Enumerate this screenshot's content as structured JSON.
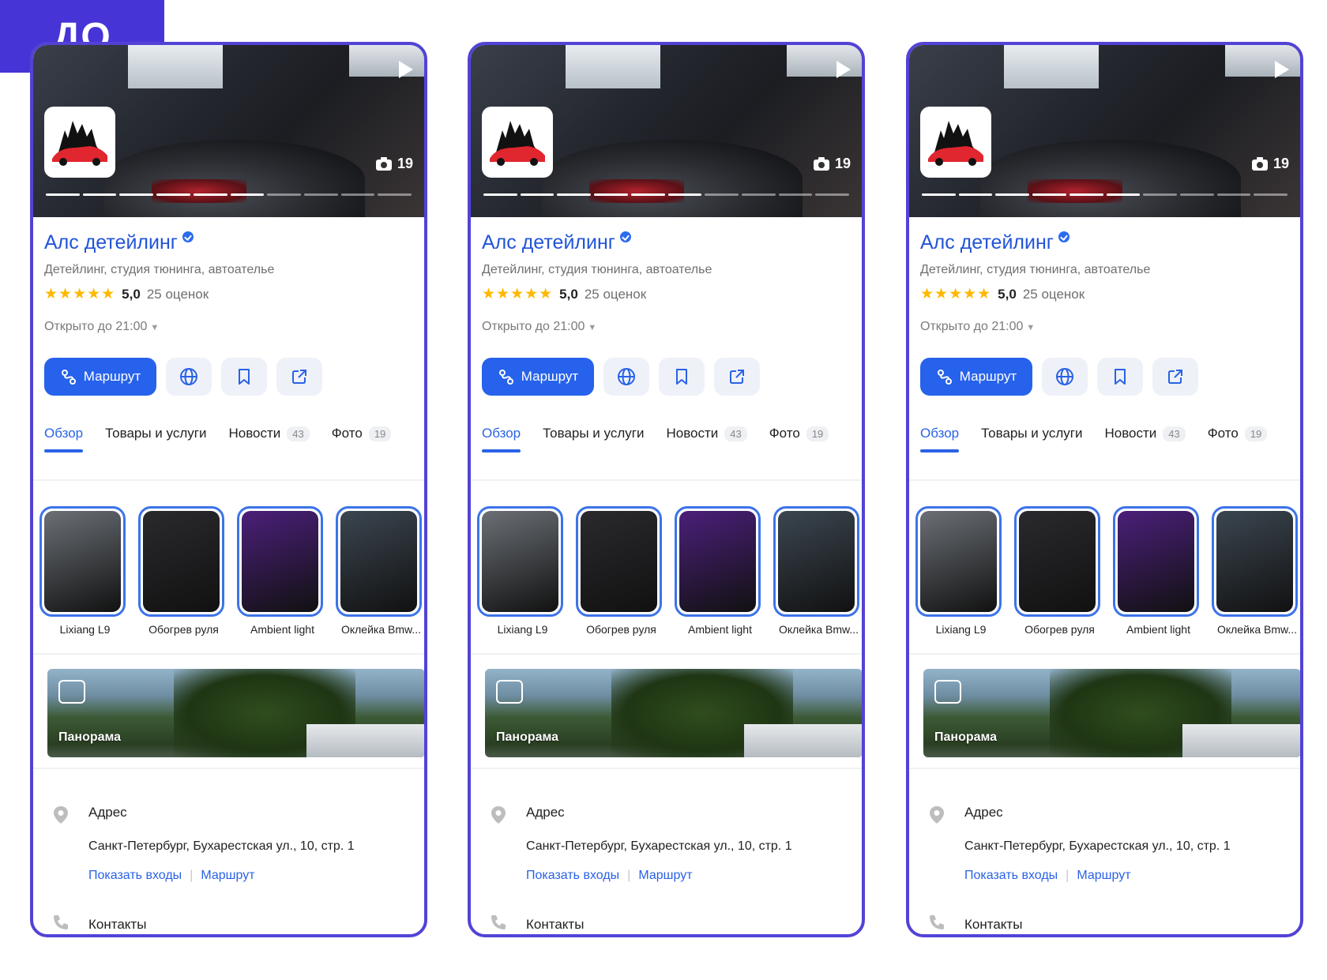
{
  "badge": "ДО",
  "card": {
    "photo_count": "19",
    "title": "Алс детейлинг",
    "subtitle": "Детейлинг, студия тюнинга, автоателье",
    "stars": "★★★★★",
    "rating": "5,0",
    "rating_count": "25 оценок",
    "hours": "Открыто до 21:00",
    "hours_caret": "▼",
    "route_label": "Маршрут",
    "tabs": [
      {
        "label": "Обзор",
        "count": ""
      },
      {
        "label": "Товары и услуги",
        "count": ""
      },
      {
        "label": "Новости",
        "count": "43"
      },
      {
        "label": "Фото",
        "count": "19"
      }
    ],
    "stories": [
      {
        "label": "Lixiang L9",
        "color": "#6b7076"
      },
      {
        "label": "Обогрев руля",
        "color": "#2a2a2e"
      },
      {
        "label": "Ambient light",
        "color": "#4b1f7a"
      },
      {
        "label": "Оклейка Bmw...",
        "color": "#3b4650"
      }
    ],
    "panorama_label": "Панорама",
    "address_head": "Адрес",
    "address_text": "Санкт-Петербург, Бухарестская ул., 10, стр. 1",
    "show_entrances": "Показать входы",
    "route_link": "Маршрут",
    "contacts_head": "Контакты"
  },
  "colors": {
    "frame": "#5243d6",
    "badge": "#4634d6",
    "accent": "#2a62e6",
    "star": "#ffb800"
  }
}
